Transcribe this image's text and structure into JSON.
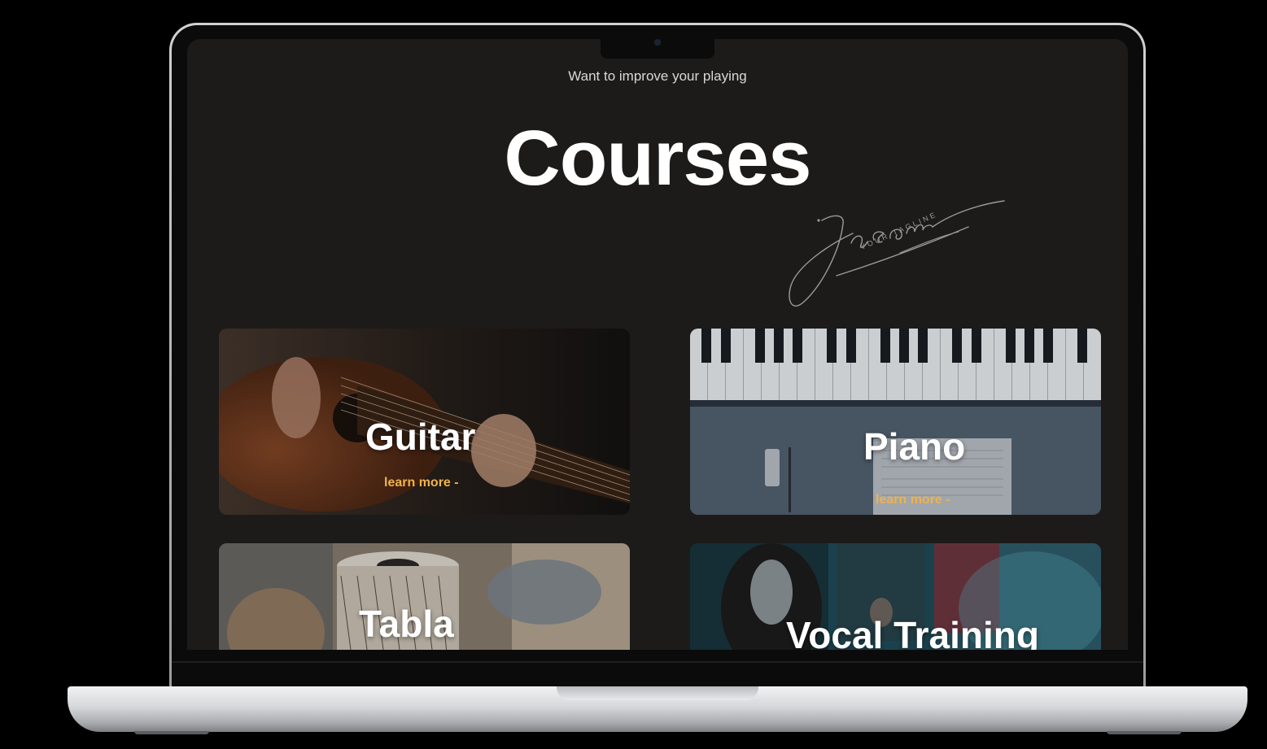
{
  "page": {
    "subtitle": "Want to improve your playing",
    "title": "Courses"
  },
  "logo": {
    "signature": "Jason",
    "tagline": "YOUR TAGLINE"
  },
  "courses": [
    {
      "title": "Guitar",
      "link_label": "learn more -"
    },
    {
      "title": "Piano",
      "link_label": "learn more -"
    },
    {
      "title": "Tabla",
      "link_label": ""
    },
    {
      "title": "Vocal Training",
      "link_label": ""
    }
  ],
  "colors": {
    "background": "#000000",
    "screen_background": "#1c1b1a",
    "accent_link": "#f0b24a",
    "title_text": "#ffffff"
  }
}
